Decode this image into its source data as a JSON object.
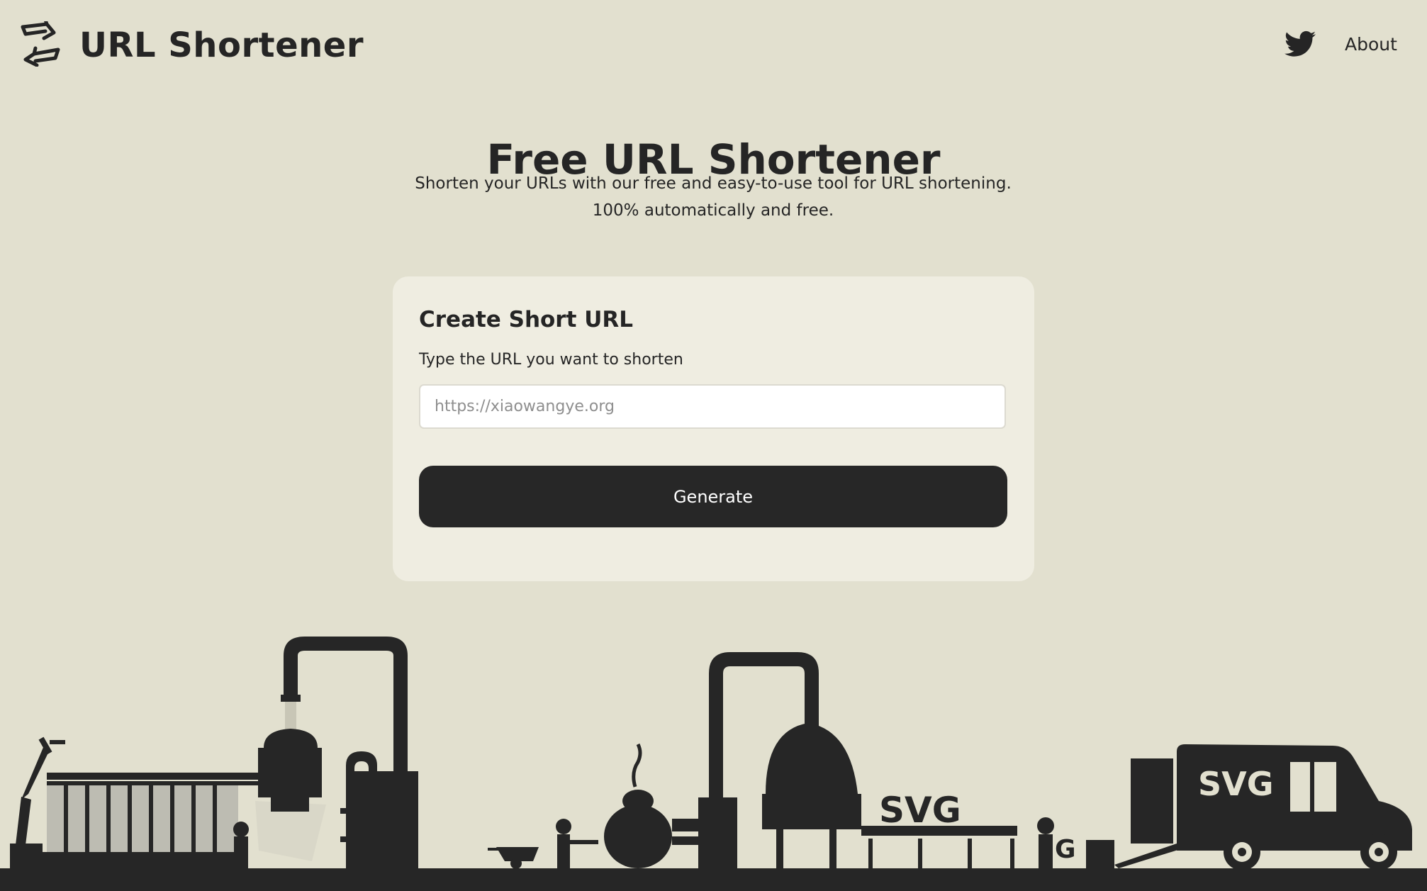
{
  "header": {
    "logo_icon": "arrows-swap-icon",
    "brand": "URL Shortener",
    "twitter_icon": "twitter-icon",
    "about_label": "About"
  },
  "hero": {
    "title": "Free URL Shortener",
    "subtitle_line1": "Shorten your URLs with our free and easy-to-use tool for URL shortening.",
    "subtitle_line2": "100% automatically and free."
  },
  "form": {
    "title": "Create Short URL",
    "label": "Type the URL you want to shorten",
    "placeholder": "https://xiaowangye.org",
    "value": "",
    "button_label": "Generate"
  },
  "illustration": {
    "name": "factory-silhouette-illustration",
    "boiler_label": "SVG",
    "truck_label": "SVG",
    "worker_letter": "G"
  },
  "colors": {
    "background": "#e2e0cf",
    "card": "#efede1",
    "ink": "#252525",
    "button": "#272727"
  }
}
